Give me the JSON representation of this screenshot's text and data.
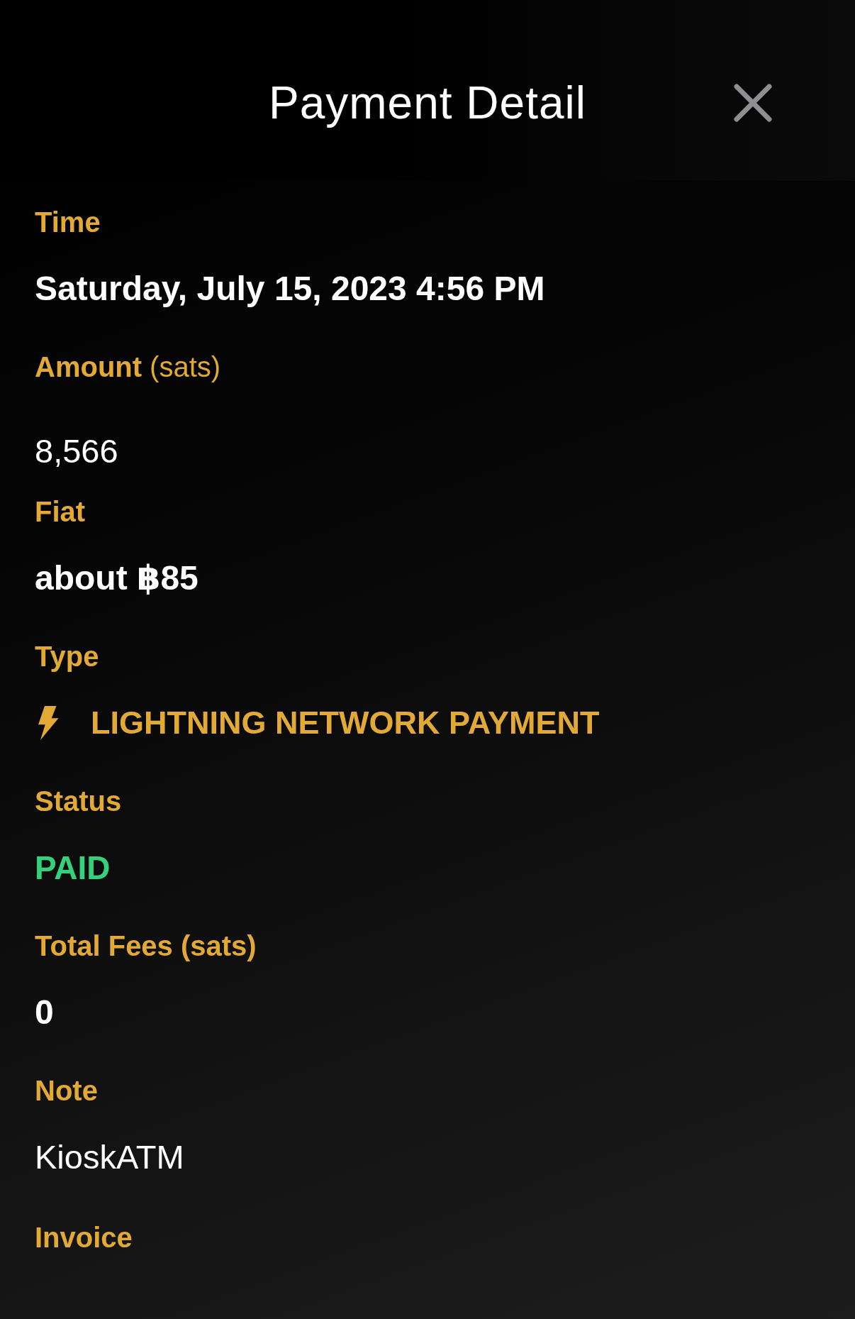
{
  "header": {
    "title": "Payment Detail"
  },
  "fields": [
    {
      "kind": "emphasis",
      "label": "Time",
      "value": "Saturday, July 15, 2023 4:56 PM"
    },
    {
      "kind": "amount",
      "label": "Amount",
      "unit": "(sats)",
      "value": "8,566"
    },
    {
      "kind": "emphasis",
      "label": "Fiat",
      "value": "about ฿85"
    },
    {
      "kind": "payment_type",
      "label": "Type",
      "value": "LIGHTNING NETWORK PAYMENT"
    },
    {
      "kind": "status",
      "label": "Status",
      "value": "PAID"
    },
    {
      "kind": "emphasis",
      "label": "Total Fees (sats)",
      "value": "0"
    },
    {
      "kind": "plain",
      "label": "Note",
      "value": "KioskATM"
    },
    {
      "kind": "invoice",
      "label": "Invoice"
    }
  ]
}
